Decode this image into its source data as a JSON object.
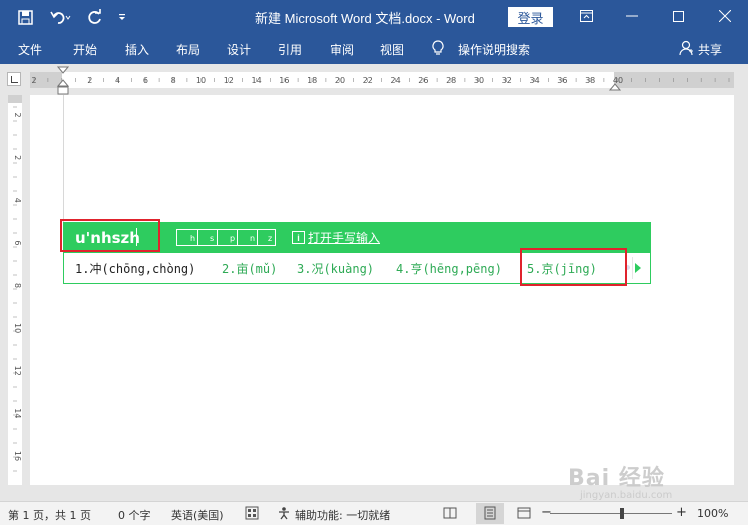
{
  "titlebar": {
    "title": "新建 Microsoft Word 文档.docx - Word",
    "login_label": "登录"
  },
  "menubar": {
    "items": [
      "文件",
      "开始",
      "插入",
      "布局",
      "设计",
      "引用",
      "审阅",
      "视图"
    ],
    "tell_me": "操作说明搜索",
    "share": "共享"
  },
  "ruler": {
    "h_labels": [
      "2",
      "2",
      "4",
      "6",
      "8",
      "10",
      "12",
      "14",
      "16",
      "18",
      "20",
      "22",
      "24",
      "26",
      "28",
      "30",
      "32",
      "34",
      "36",
      "38",
      "40"
    ],
    "v_labels": [
      "2",
      "2",
      "4",
      "6",
      "8",
      "10",
      "12",
      "14",
      "16",
      "18"
    ]
  },
  "ime": {
    "input": "u'nhszh",
    "strokes": [
      "h",
      "s",
      "p",
      "n",
      "z"
    ],
    "handwrite_label": "打开手写输入",
    "candidates": [
      "1.冲(chōng,chòng)",
      "2.亩(mǔ)",
      "3.况(kuàng)",
      "4.亨(hēng,pēng)",
      "5.京(jīng)"
    ]
  },
  "status": {
    "page": "第 1 页，共 1 页",
    "words": "0 个字",
    "language": "英语(美国)",
    "accessibility": "辅助功能: 一切就绪",
    "zoom": "100%",
    "zoom_level": 100
  },
  "watermark": {
    "brand": "Bai 经验",
    "url": "jingyan.baidu.com"
  },
  "colors": {
    "ribbon": "#2b579a",
    "ime_green": "#2ecc5f",
    "highlight_red": "#e0232d"
  }
}
